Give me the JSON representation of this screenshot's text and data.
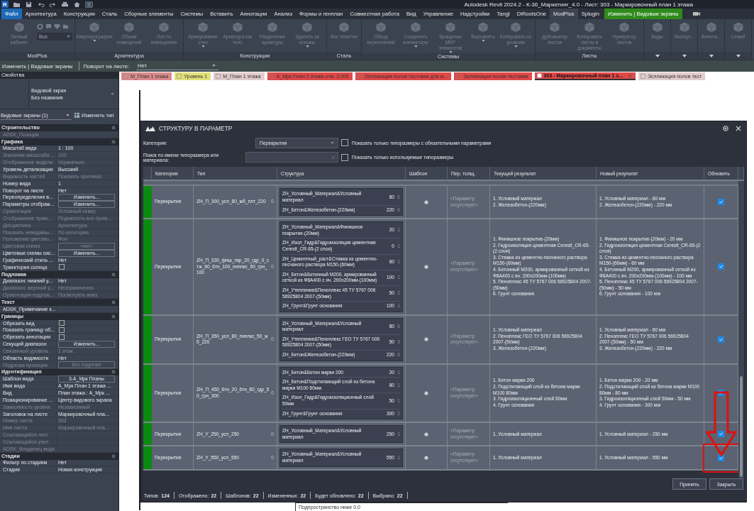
{
  "title_bar": {
    "app_logo": "R",
    "title": "Autodesk Revit 2024.2 - К-36_Маркетинг_4.0 - Лист: 303 - Маркировочный план 1 этажа"
  },
  "menu_tabs": [
    {
      "label": "Файл",
      "kind": "file",
      "selected": false
    },
    {
      "label": "Архитектура",
      "kind": "tab",
      "selected": false
    },
    {
      "label": "Конструкция",
      "kind": "tab",
      "selected": false
    },
    {
      "label": "Сталь",
      "kind": "tab",
      "selected": false
    },
    {
      "label": "Сборные элементы",
      "kind": "tab",
      "selected": false
    },
    {
      "label": "Системы",
      "kind": "tab",
      "selected": false
    },
    {
      "label": "Вставить",
      "kind": "tab",
      "selected": false
    },
    {
      "label": "Аннотации",
      "kind": "tab",
      "selected": false
    },
    {
      "label": "Анализ",
      "kind": "tab",
      "selected": false
    },
    {
      "label": "Формы и генплан",
      "kind": "tab",
      "selected": false
    },
    {
      "label": "Совместная работа",
      "kind": "tab",
      "selected": false
    },
    {
      "label": "Вид",
      "kind": "tab",
      "selected": false
    },
    {
      "label": "Управление",
      "kind": "tab",
      "selected": false
    },
    {
      "label": "Надстройки",
      "kind": "tab",
      "selected": false
    },
    {
      "label": "Tangl",
      "kind": "tab",
      "selected": false
    },
    {
      "label": "DiRootsOne",
      "kind": "tab",
      "selected": false
    },
    {
      "label": "ModPlus",
      "kind": "tab",
      "selected": true
    },
    {
      "label": "Splugin",
      "kind": "tab",
      "selected": false
    },
    {
      "label": "Изменить | Видовые экраны",
      "kind": "context",
      "selected": false
    }
  ],
  "ribbon": [
    {
      "title": "ModPlus",
      "combo": "Все",
      "menu": false,
      "buttons": [
        {
          "label": "Личный кабинет",
          "disabled": true,
          "dropdown": false
        }
      ]
    },
    {
      "title": "Архитектура",
      "menu": false,
      "buttons": [
        {
          "label": "Квартирография",
          "disabled": true,
          "dropdown": true
        },
        {
          "label": "Объем помещений",
          "disabled": true,
          "dropdown": false
        },
        {
          "label": "Пол по помещению",
          "disabled": true,
          "dropdown": false
        }
      ]
    },
    {
      "title": "Конструкции",
      "menu": false,
      "buttons": [
        {
          "label": "Армирование стен",
          "disabled": true,
          "dropdown": true
        },
        {
          "label": "Арматура как тело",
          "disabled": true,
          "dropdown": false
        },
        {
          "label": "Разделение арматуры",
          "disabled": true,
          "dropdown": false
        },
        {
          "label": "Удалить из основы",
          "disabled": true,
          "dropdown": true
        }
      ]
    },
    {
      "title": "Сталь",
      "menu": false,
      "buttons": [
        {
          "label": "Вес пластин",
          "disabled": true,
          "dropdown": false
        }
      ]
    },
    {
      "title": "Системы",
      "menu": false,
      "buttons": [
        {
          "label": "Обход пересечений",
          "disabled": true,
          "dropdown": false
        },
        {
          "label": "Соединить коннекторы",
          "disabled": true,
          "dropdown": true
        },
        {
          "label": "Вращение MEP элементов",
          "disabled": true,
          "dropdown": true
        },
        {
          "label": "Выровнять",
          "disabled": true,
          "dropdown": true
        },
        {
          "label": "Копировать по уровням",
          "disabled": true,
          "dropdown": true
        }
      ]
    },
    {
      "title": "Листы",
      "menu": false,
      "buttons": [
        {
          "label": "Дубликатор листов",
          "disabled": true,
          "dropdown": false
        },
        {
          "label": "Копировать листы в документы",
          "disabled": true,
          "dropdown": false
        },
        {
          "label": "Нумератор листов",
          "disabled": true,
          "dropdown": false
        }
      ]
    },
    {
      "menu": true,
      "buttons": [
        {
          "label": "Виды",
          "disabled": true,
          "dropdown": false
        }
      ]
    },
    {
      "menu": true,
      "buttons": [
        {
          "label": "Экспорт...",
          "disabled": true,
          "dropdown": false
        }
      ]
    },
    {
      "menu": true,
      "buttons": [
        {
          "label": "Аннота...",
          "disabled": true,
          "dropdown": false
        }
      ]
    },
    {
      "menu": true,
      "buttons": [
        {
          "label": "Семей",
          "disabled": true,
          "dropdown": false
        }
      ]
    }
  ],
  "options_bar": {
    "context": "Изменить | Видовые экраны",
    "label": "Поворот на листе:",
    "value": "Нет"
  },
  "properties": {
    "title": "Свойства",
    "type_family": "Видовой экран",
    "type_name": "Без названия",
    "selector": "Видовые экраны (1)",
    "edit_type": "Изменить тип",
    "sections": [
      {
        "title": "Строительство",
        "rows": [
          {
            "label": "ADSK_Позиция",
            "kind": "text",
            "disabled": true
          }
        ]
      },
      {
        "title": "Графика",
        "rows": [
          {
            "label": "Масштаб вида",
            "kind": "text",
            "value": "1 : 100",
            "disabled": false
          },
          {
            "label": "Значение масштаба ...",
            "kind": "text",
            "value": "100",
            "disabled": true
          },
          {
            "label": "Отображение модели",
            "kind": "text",
            "value": "Нормально",
            "disabled": true
          },
          {
            "label": "Уровень детализации",
            "kind": "text",
            "value": "Высокий",
            "disabled": false
          },
          {
            "label": "Видимость частей",
            "kind": "text",
            "value": "Показать оригинал",
            "disabled": true
          },
          {
            "label": "Номер вида",
            "kind": "text",
            "value": "1",
            "disabled": false
          },
          {
            "label": "Поворот на листе",
            "kind": "text",
            "value": "Нет",
            "disabled": false
          },
          {
            "label": "Переопределения в...",
            "kind": "button",
            "value": "Изменить...",
            "disabled": false
          },
          {
            "label": "Параметры отображ...",
            "kind": "button",
            "value": "Изменить...",
            "disabled": false
          },
          {
            "label": "Ориентация",
            "kind": "text",
            "value": "Условный север",
            "disabled": true
          },
          {
            "label": "Отображение прим...",
            "kind": "text",
            "value": "Подчистить все прим...",
            "disabled": true
          },
          {
            "label": "Дисциплина",
            "kind": "text",
            "value": "Архитектура",
            "disabled": true
          },
          {
            "label": "Показать невидимы...",
            "kind": "text",
            "value": "По категории",
            "disabled": true
          },
          {
            "label": "Положение цветово...",
            "kind": "text",
            "value": "Фон",
            "disabled": true
          },
          {
            "label": "Цветовая схема",
            "kind": "button",
            "value": "<нет>",
            "disabled": true
          },
          {
            "label": "Цветовые схемы сис...",
            "kind": "button",
            "value": "Изменить...",
            "disabled": false
          },
          {
            "label": "Графический стиль ...",
            "kind": "text",
            "value": "Нет",
            "disabled": false
          },
          {
            "label": "Траектория солнца",
            "kind": "checkbox",
            "checked": false,
            "disabled": false
          }
        ]
      },
      {
        "title": "Подложка",
        "rows": [
          {
            "label": "Диапазон: нижний у...",
            "kind": "text",
            "value": "Нет",
            "disabled": false
          },
          {
            "label": "Диапазон: верхний у...",
            "kind": "text",
            "value": "Неограниченно",
            "disabled": true
          },
          {
            "label": "Ориентация подлож...",
            "kind": "text",
            "value": "Посмотреть вниз",
            "disabled": true
          }
        ]
      },
      {
        "title": "Текст",
        "rows": [
          {
            "label": "ADSK_Примечание к...",
            "kind": "text",
            "disabled": false
          }
        ]
      },
      {
        "title": "Границы",
        "rows": [
          {
            "label": "Обрезать вид",
            "kind": "checkbox",
            "checked": false,
            "disabled": false
          },
          {
            "label": "Показать границу об...",
            "kind": "checkbox",
            "checked": false,
            "disabled": false
          },
          {
            "label": "Обрезать аннотации",
            "kind": "checkbox",
            "checked": false,
            "disabled": false
          },
          {
            "label": "Секущий диапазон",
            "kind": "button",
            "value": "Изменить...",
            "disabled": false
          },
          {
            "label": "Связанный уровень",
            "kind": "text",
            "value": "1 этаж",
            "disabled": true
          },
          {
            "label": "Область видимости",
            "kind": "text",
            "value": "Нет",
            "disabled": false
          },
          {
            "label": "Подрезка проекции",
            "kind": "button",
            "value": "Без подрезки",
            "disabled": true
          }
        ]
      },
      {
        "title": "Идентификация",
        "rows": [
          {
            "label": "Шаблон вида",
            "kind": "button",
            "value": "3-А_Мрк Планы",
            "disabled": false
          },
          {
            "label": "Имя вида",
            "kind": "text",
            "value": "А_Мрк План 1 этажа ...",
            "disabled": false
          },
          {
            "label": "Вид",
            "kind": "text",
            "value": "План этажа : А_Мрк ...",
            "disabled": false
          },
          {
            "label": "Позиционирование ...",
            "kind": "text",
            "value": "Центр видового экрана",
            "disabled": false
          },
          {
            "label": "Зависимость уровня",
            "kind": "text",
            "value": "Независимый",
            "disabled": true
          },
          {
            "label": "Заголовок на листе",
            "kind": "text",
            "value": "Маркировочный пла...",
            "disabled": false
          },
          {
            "label": "Номер листа",
            "kind": "text",
            "value": "303",
            "disabled": true
          },
          {
            "label": "Имя листа",
            "kind": "text",
            "value": "Маркировочный пла...",
            "disabled": true
          },
          {
            "label": "Ссылающийся лист",
            "kind": "text",
            "disabled": true
          },
          {
            "label": "Ссылающийся узел",
            "kind": "text",
            "disabled": true
          },
          {
            "label": "ADSK_Владелец вида",
            "kind": "text",
            "disabled": true
          }
        ]
      },
      {
        "title": "Стадии",
        "rows": [
          {
            "label": "Фильтр по стадиям",
            "kind": "text",
            "value": "Нет",
            "disabled": false
          },
          {
            "label": "Стадия",
            "kind": "text",
            "value": "Новая конструкция",
            "disabled": false
          }
        ]
      }
    ]
  },
  "view_tabs": [
    {
      "label": "М_План 1 этажа",
      "color": "#d98a8a",
      "selected": false
    },
    {
      "label": "Уровень 1",
      "color": "#e2e07a",
      "selected": false
    },
    {
      "label": "М_План 1 этажа",
      "color": "#e2cccc",
      "selected": false
    },
    {
      "label": "А_Мрк План 2 этажа отм. 3.000",
      "color": "#e04848",
      "selected": false
    },
    {
      "label": "Эспликация полов тестовая для м...",
      "color": "#e04848",
      "selected": false
    },
    {
      "label": "Эспликация полов тестовая",
      "color": "#e04848",
      "selected": false
    },
    {
      "label": "303 - Маркировочный план 1 э...",
      "color": "#e04848",
      "selected": true
    },
    {
      "label": "Эспликация полов тест",
      "color": "#e2cccc",
      "selected": false
    }
  ],
  "canvas_label": "Подпространство ниже 0.0",
  "dialog": {
    "title": "СТРУКТУРУ В ПАРАМЕТР",
    "category_label": "Категория:",
    "category_value": "Перекрытия",
    "search_label": "Поиск по имени типоразмера или материала:",
    "filters": [
      {
        "label": "Показать только типоразмеры с обязательными параметрами",
        "checked": false
      },
      {
        "label": "Показать только используемые типоразмеры",
        "checked": false
      }
    ],
    "columns": [
      "Категория",
      "Тип",
      "Структура",
      "Шаблон",
      "Пер. толщ.",
      "Текущий результат",
      "Новый результат",
      "Обновить"
    ],
    "rows": [
      {
        "category": "Перекрытия",
        "type": "ZH_П_300_усл_80_жб_плт_220",
        "type_count": "0",
        "layers": [
          {
            "name": "ZH_Условный_Материал&Условный материал",
            "thickness": "80",
            "count": "6"
          },
          {
            "name": "ZH_Бетон&Железобетон-(220мм)",
            "thickness": "220",
            "count": "6"
          }
        ],
        "thickness_param": "<Параметр отсутствует>",
        "current": [
          "1. Условный материал",
          "2. Железобетон-(220мм)"
        ],
        "new": [
          "1. Условный материал - 80 мм",
          "2. Железобетон-(220мм) - 220 мм"
        ],
        "update": true,
        "highlighted": false
      },
      {
        "category": "Перекрытия",
        "type": "ZH_П_330_фнш_пкр_20_гдр_0_стж_60_6тн_100_пнплкс_50_грн_100",
        "type_count": "0",
        "layers": [
          {
            "name": "ZH_Условный_Материал&Финишное покрытие-(20мм)",
            "thickness": "20",
            "count": "1"
          },
          {
            "name": "ZH_Изол_Гидр&Гидроизоляция цементная Ceresit_CR-65-(2 слоя)",
            "thickness": "0",
            "count": "1"
          },
          {
            "name": "ZH_Цементный_раст&Стяжка из цементно-песчаного раствора М150-(60мм)",
            "thickness": "60",
            "count": "1"
          },
          {
            "name": "ZH_Бетон&Бетонный М200, армированный сеткой из Ф8А400 с яч. 200х200мм-(100мм)",
            "thickness": "100",
            "count": "1"
          },
          {
            "name": "ZH_Утепление&Пеноплекс 45 ТУ 5767 006 56925804 2007-(50мм)",
            "thickness": "50",
            "count": "2"
          },
          {
            "name": "ZH_Грунт&Грунт основания",
            "thickness": "100",
            "count": "1"
          }
        ],
        "thickness_param": "<Параметр отсутствует>",
        "current": [
          "1. Финишное покрытие-(20мм)",
          "2. Гидроизоляция цементная Ceresit_CR-65-(2 слоя)",
          "3. Стяжка из цементно-песчаного раствора М150-(60мм)",
          "4. Бетонный М200, армированный сеткой из Ф8А400 с яч. 200х200мм-(100мм)",
          "5. Пеноплекс 45 ТУ 5767 006 56925804 2007-(50мм)",
          "6. Грунт основания"
        ],
        "new": [
          "1. Финишное покрытие-(20мм) - 20 мм",
          "2. Гидроизоляция цементная Ceresit_CR-65-(2 слоя)",
          "3. Стяжка из цементно-песчаного раствора М150-(60мм) - 60 мм",
          "4. Бетонный М200, армированный сеткой из Ф8А400 с яч. 200х200мм-(100мм) - 100 мм",
          "5. Пеноплекс 45 ТУ 5767 006 56925804 2007-(50мм) - 50 мм",
          "6. Грунт основания - 100 мм"
        ],
        "update": true,
        "highlighted": false
      },
      {
        "category": "Перекрытия",
        "type": "ZH_П_350_усл_80_пнплкс_50_жб_220",
        "type_count": "0",
        "layers": [
          {
            "name": "ZH_Условный_Материал&Условный материал",
            "thickness": "80",
            "count": "6"
          },
          {
            "name": "ZH_Утепление&Пеноплекс ГЕО ТУ 5767 006 56925804 2007-(50мм)",
            "thickness": "50",
            "count": "3"
          },
          {
            "name": "ZH_Бетон&Железобетон-(220мм)",
            "thickness": "220",
            "count": "6"
          }
        ],
        "thickness_param": "<Параметр отсутствует>",
        "current": [
          "1. Условный материал",
          "2. Пеноплекс ГЕО ТУ 5767 006 56925804 2007-(50мм)",
          "3. Железобетон-(220мм)"
        ],
        "new": [
          "1. Условный материал - 80 мм",
          "2. Пеноплекс ГЕО ТУ 5767 006 56925804 2007-(50мм) - 50 мм",
          "3. Железобетон-(220мм) - 220 мм"
        ],
        "update": true,
        "highlighted": false
      },
      {
        "category": "Перекрытия",
        "type": "ZH_П_450_6тн_20_6тн_80_гдр_50_грн_300",
        "type_count": "0",
        "layers": [
          {
            "name": "ZH_Бетон&Бетон марки 200",
            "thickness": "20",
            "count": "1"
          },
          {
            "name": "ZH_Бетон&Подстилающий слой из бетона марки М100 80мм",
            "thickness": "80",
            "count": "1"
          },
          {
            "name": "ZH_Изол_Гидр&Гидроизоляционный слой 50мм",
            "thickness": "50",
            "count": "1"
          },
          {
            "name": "ZH_Грунт&Грунт основания",
            "thickness": "300",
            "count": "2"
          }
        ],
        "thickness_param": "<Параметр отсутствует>",
        "current": [
          "1. Бетон марки 200",
          "2. Подстилающий слой из бетона марки М100 80мм",
          "3. Гидроизоляционный слой 50мм",
          "4. Грунт основания"
        ],
        "new": [
          "1. Бетон марки 200 - 20 мм",
          "2. Подстилающий слой из бетона марки М100 80мм - 80 мм",
          "3. Гидроизоляционный слой 50мм - 50 мм",
          "4. Грунт основания - 300 мм"
        ],
        "update": true,
        "highlighted": false
      },
      {
        "category": "Перекрытия",
        "type": "ZH_У_250_усл_250",
        "type_count": "0",
        "layers": [
          {
            "name": "ZH_Условный_Материал&Условный материал",
            "thickness": "250",
            "count": "1"
          }
        ],
        "thickness_param": "<Параметр отсутствует>",
        "current": [
          "1. Условный материал"
        ],
        "new": [
          "1. Условный материал - 250 мм"
        ],
        "update": true,
        "highlighted": false
      },
      {
        "category": "Перекрытия",
        "type": "ZH_У_550_усл_550",
        "type_count": "0",
        "layers": [
          {
            "name": "ZH_Условный_Материал&Условный материал",
            "thickness": "550",
            "count": "1"
          }
        ],
        "thickness_param": "<Параметр отсутствует>",
        "current": [
          "1. Условный материал"
        ],
        "new": [
          "1. Условный материал - 550 мм"
        ],
        "update": true,
        "highlighted": true
      }
    ],
    "status": [
      {
        "label": "Типов:",
        "value": "124"
      },
      {
        "label": "Отображено:",
        "value": "22"
      },
      {
        "label": "Шаблонов:",
        "value": "22"
      },
      {
        "label": "Измененных:",
        "value": "22"
      },
      {
        "label": "Будет обновлено:",
        "value": "22"
      },
      {
        "label": "Выбрано:",
        "value": "22"
      }
    ],
    "buttons": [
      "Принять",
      "Закрыть"
    ]
  }
}
